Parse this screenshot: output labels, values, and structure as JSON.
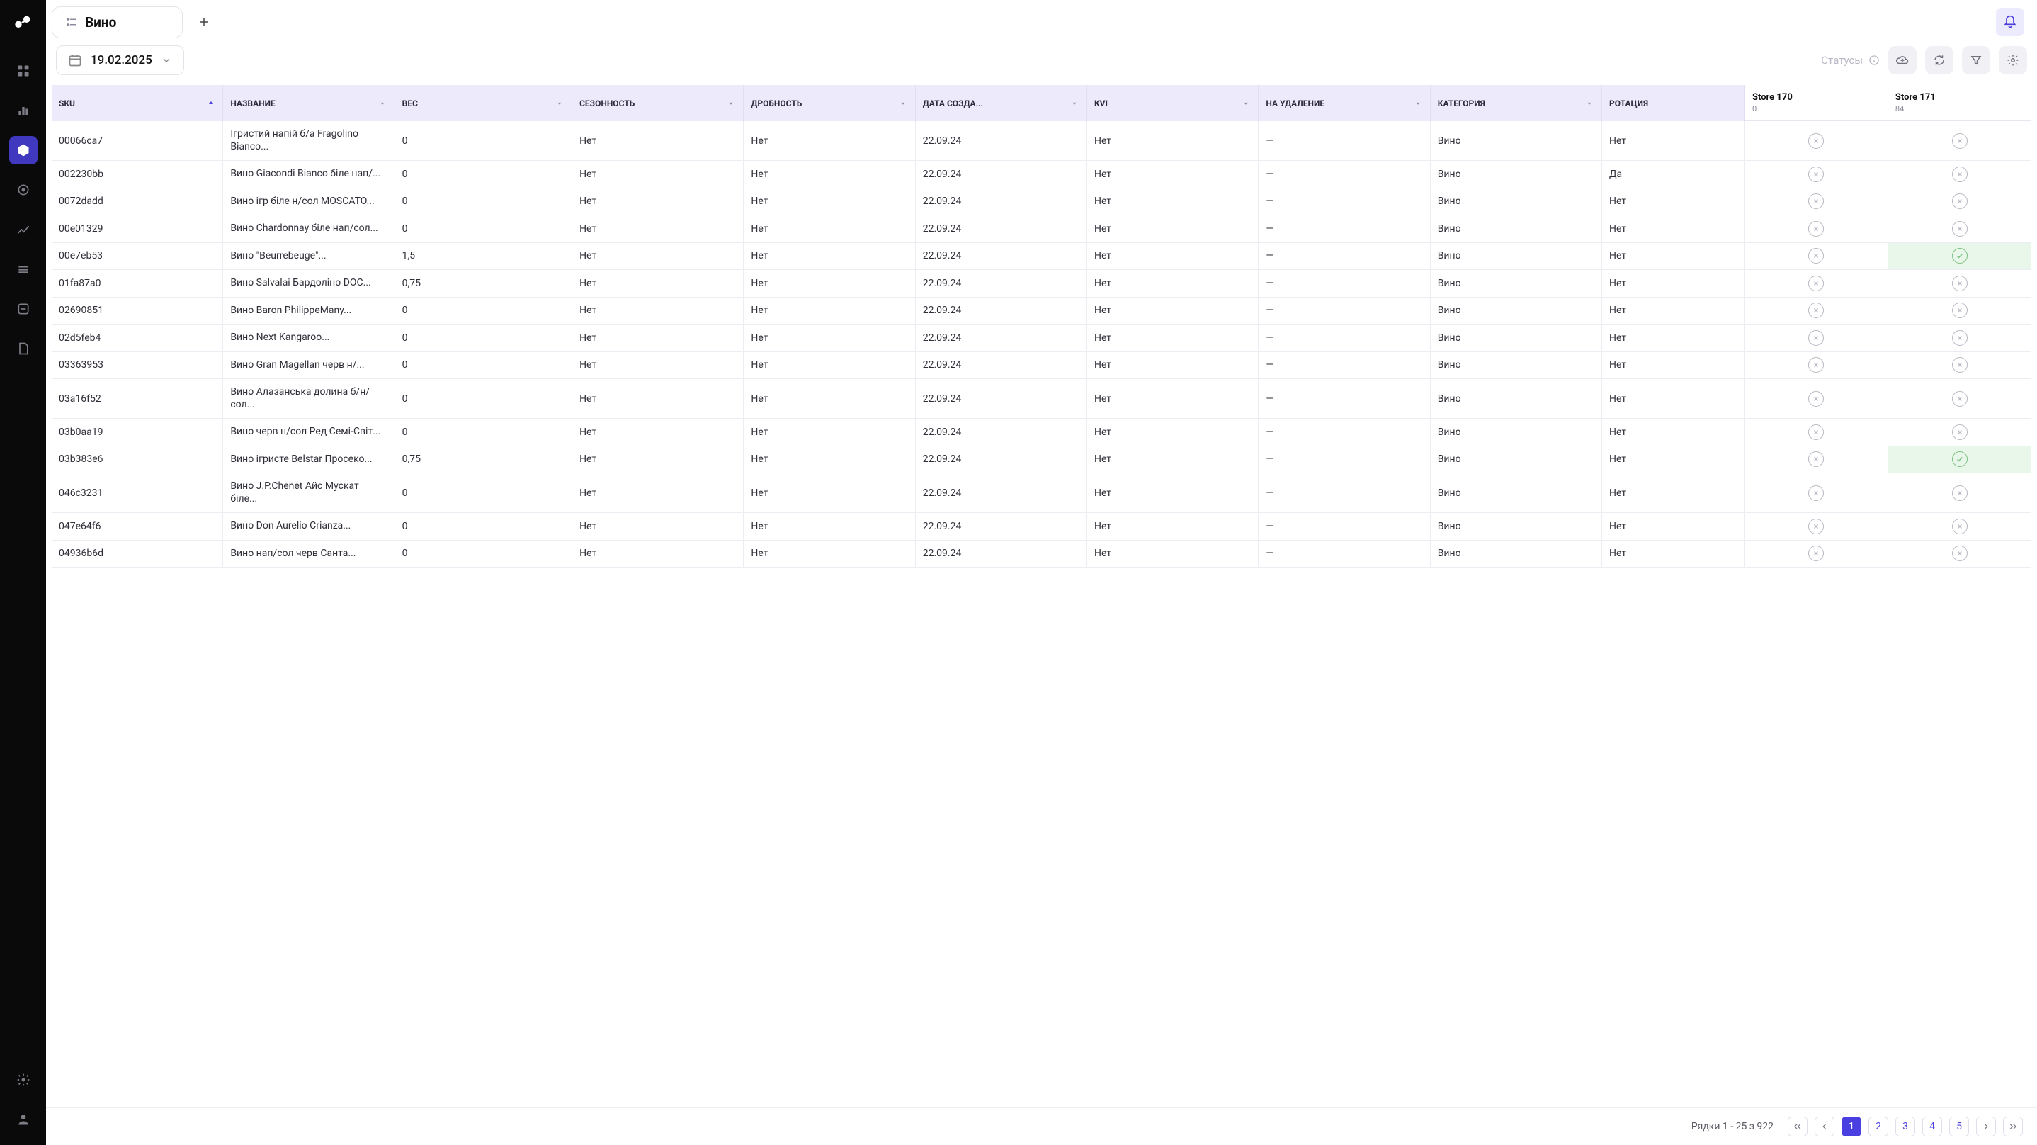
{
  "tab": {
    "title": "Вино"
  },
  "date": "19.02.2025",
  "statuses_label": "Статусы",
  "columns": {
    "sku": "SKU",
    "name": "НАЗВАНИЕ",
    "weight": "ВЕС",
    "seasonality": "СЕЗОННОСТЬ",
    "fractionality": "ДРОБНОСТЬ",
    "created": "ДАТА СОЗДА...",
    "kvi": "KVI",
    "for_deletion": "НА УДАЛЕНИЕ",
    "category": "КАТЕГОРИЯ",
    "rotation": "РОТАЦИЯ"
  },
  "stores": [
    {
      "name": "Store 170",
      "sub": "0"
    },
    {
      "name": "Store 171",
      "sub": "84"
    }
  ],
  "rows": [
    {
      "sku": "00066ca7",
      "name": "Ігристий напій б/а Fragolino Bianco...",
      "weight": "0",
      "season": "Нет",
      "frac": "Нет",
      "date": "22.09.24",
      "kvi": "Нет",
      "del": "—",
      "cat": "Вино",
      "rot": "Нет",
      "s170": "x",
      "s171": "x"
    },
    {
      "sku": "002230bb",
      "name": "Вино Giacondi Bianco біле нап/...",
      "weight": "0",
      "season": "Нет",
      "frac": "Нет",
      "date": "22.09.24",
      "kvi": "Нет",
      "del": "—",
      "cat": "Вино",
      "rot": "Да",
      "s170": "x",
      "s171": "x"
    },
    {
      "sku": "0072dadd",
      "name": "Вино ігр біле н/сол MOSCATO...",
      "weight": "0",
      "season": "Нет",
      "frac": "Нет",
      "date": "22.09.24",
      "kvi": "Нет",
      "del": "—",
      "cat": "Вино",
      "rot": "Нет",
      "s170": "x",
      "s171": "x"
    },
    {
      "sku": "00e01329",
      "name": "Вино Chardonnay біле нап/сол...",
      "weight": "0",
      "season": "Нет",
      "frac": "Нет",
      "date": "22.09.24",
      "kvi": "Нет",
      "del": "—",
      "cat": "Вино",
      "rot": "Нет",
      "s170": "x",
      "s171": "x"
    },
    {
      "sku": "00e7eb53",
      "name": "Вино \"Beurrebeuge\"...",
      "weight": "1,5",
      "season": "Нет",
      "frac": "Нет",
      "date": "22.09.24",
      "kvi": "Нет",
      "del": "—",
      "cat": "Вино",
      "rot": "Нет",
      "s170": "x",
      "s171": "ok"
    },
    {
      "sku": "01fa87a0",
      "name": "Вино Salvalai Бардоліно DOC...",
      "weight": "0,75",
      "season": "Нет",
      "frac": "Нет",
      "date": "22.09.24",
      "kvi": "Нет",
      "del": "—",
      "cat": "Вино",
      "rot": "Нет",
      "s170": "x",
      "s171": "x"
    },
    {
      "sku": "02690851",
      "name": "Вино Baron PhilippeMany...",
      "weight": "0",
      "season": "Нет",
      "frac": "Нет",
      "date": "22.09.24",
      "kvi": "Нет",
      "del": "—",
      "cat": "Вино",
      "rot": "Нет",
      "s170": "x",
      "s171": "x"
    },
    {
      "sku": "02d5feb4",
      "name": "Вино Next Kangaroo...",
      "weight": "0",
      "season": "Нет",
      "frac": "Нет",
      "date": "22.09.24",
      "kvi": "Нет",
      "del": "—",
      "cat": "Вино",
      "rot": "Нет",
      "s170": "x",
      "s171": "x"
    },
    {
      "sku": "03363953",
      "name": "Вино Gran Magellan черв н/...",
      "weight": "0",
      "season": "Нет",
      "frac": "Нет",
      "date": "22.09.24",
      "kvi": "Нет",
      "del": "—",
      "cat": "Вино",
      "rot": "Нет",
      "s170": "x",
      "s171": "x"
    },
    {
      "sku": "03a16f52",
      "name": "Вино Алазанська долина б/н/сол...",
      "weight": "0",
      "season": "Нет",
      "frac": "Нет",
      "date": "22.09.24",
      "kvi": "Нет",
      "del": "—",
      "cat": "Вино",
      "rot": "Нет",
      "s170": "x",
      "s171": "x"
    },
    {
      "sku": "03b0aa19",
      "name": "Вино черв н/сол Ред Семі-Світ...",
      "weight": "0",
      "season": "Нет",
      "frac": "Нет",
      "date": "22.09.24",
      "kvi": "Нет",
      "del": "—",
      "cat": "Вино",
      "rot": "Нет",
      "s170": "x",
      "s171": "x"
    },
    {
      "sku": "03b383e6",
      "name": "Вино ігристе Belstar Просеко...",
      "weight": "0,75",
      "season": "Нет",
      "frac": "Нет",
      "date": "22.09.24",
      "kvi": "Нет",
      "del": "—",
      "cat": "Вино",
      "rot": "Нет",
      "s170": "x",
      "s171": "ok"
    },
    {
      "sku": "046c3231",
      "name": "Вино J.P.Chenet Айс Мускат біле...",
      "weight": "0",
      "season": "Нет",
      "frac": "Нет",
      "date": "22.09.24",
      "kvi": "Нет",
      "del": "—",
      "cat": "Вино",
      "rot": "Нет",
      "s170": "x",
      "s171": "x"
    },
    {
      "sku": "047e64f6",
      "name": "Вино Don Aurelio Crianza...",
      "weight": "0",
      "season": "Нет",
      "frac": "Нет",
      "date": "22.09.24",
      "kvi": "Нет",
      "del": "—",
      "cat": "Вино",
      "rot": "Нет",
      "s170": "x",
      "s171": "x"
    },
    {
      "sku": "04936b6d",
      "name": "Вино нап/сол черв Санта...",
      "weight": "0",
      "season": "Нет",
      "frac": "Нет",
      "date": "22.09.24",
      "kvi": "Нет",
      "del": "—",
      "cat": "Вино",
      "rot": "Нет",
      "s170": "x",
      "s171": "x"
    }
  ],
  "pagination": {
    "rows_label": "Рядки 1 - 25 з 922",
    "pages": [
      "1",
      "2",
      "3",
      "4",
      "5"
    ]
  }
}
